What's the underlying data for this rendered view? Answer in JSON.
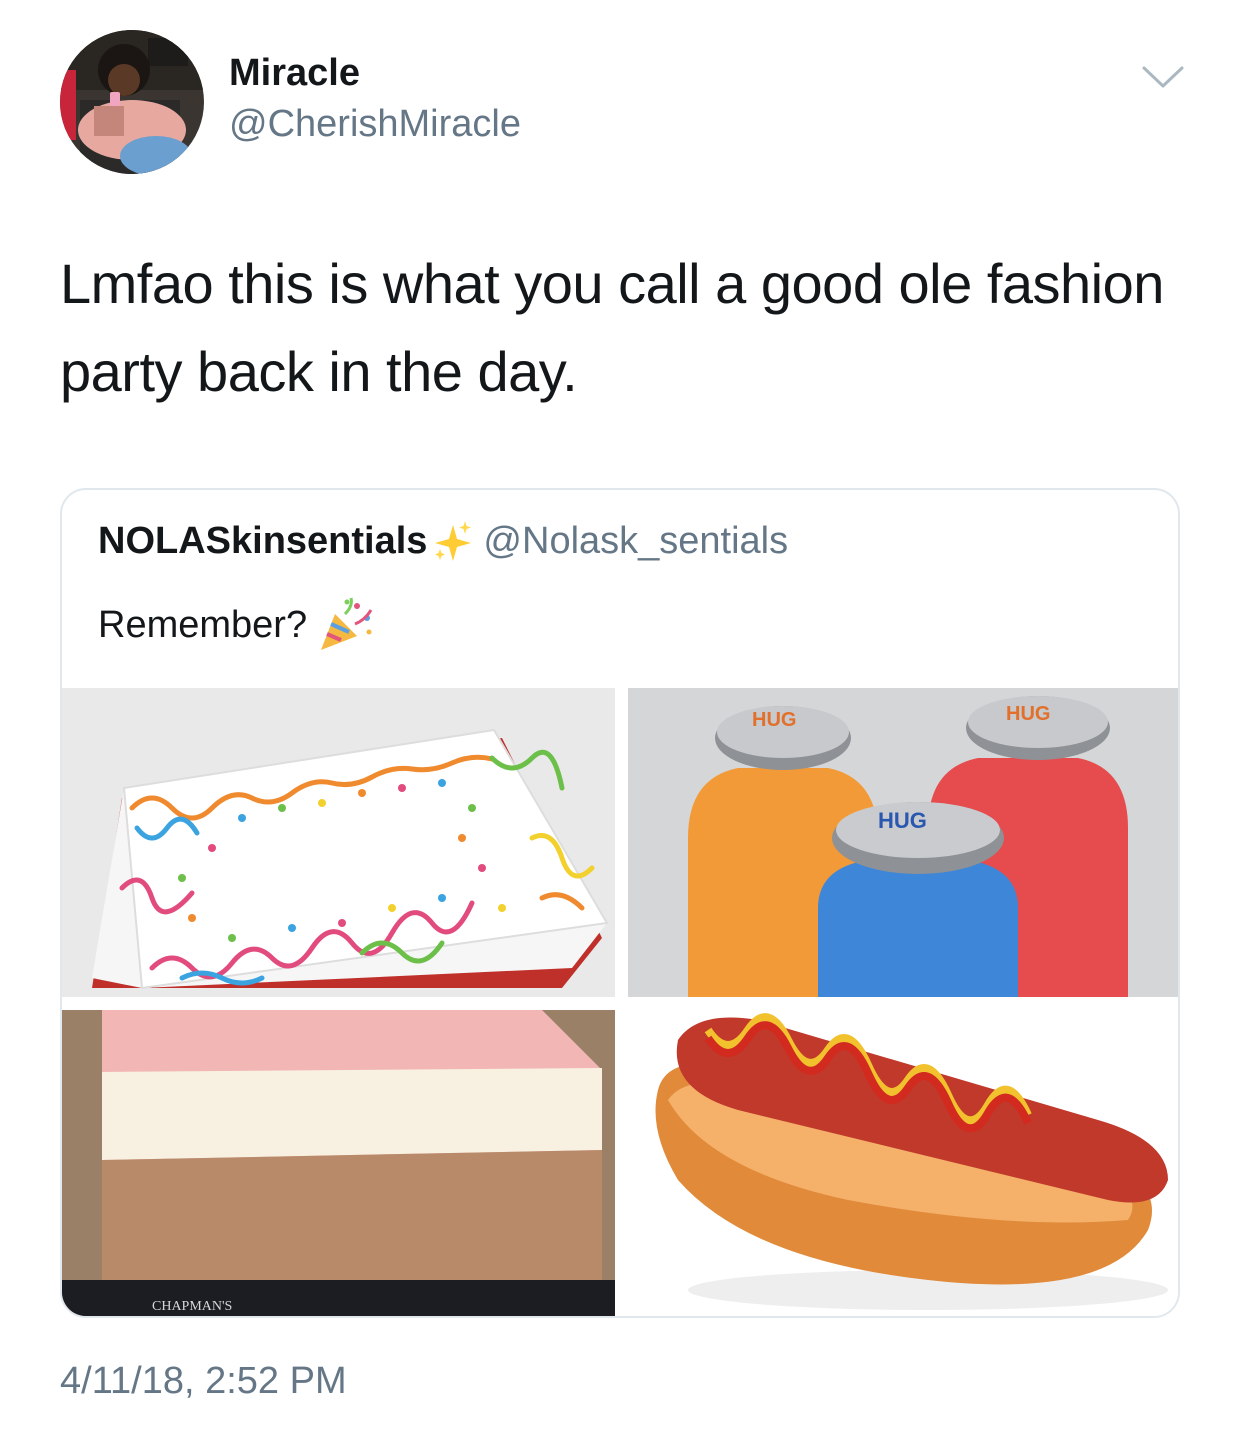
{
  "tweet": {
    "display_name": "Miracle",
    "handle": "@CherishMiracle",
    "text": "Lmfao this is what you call a good ole fashion party back in the day.",
    "timestamp": "4/11/18, 2:52 PM"
  },
  "quoted_tweet": {
    "display_name": "NOLASkinsentials",
    "handle": "@Nolask_sentials",
    "text": "Remember?",
    "name_emoji": "sparkles-icon",
    "text_emoji": "party-popper-icon",
    "media": [
      {
        "name": "sheet-cake-image",
        "bottle_cap_labels": []
      },
      {
        "name": "hug-juice-bottles-image",
        "bottle_cap_labels": [
          "HUG",
          "HUG",
          "HUG"
        ]
      },
      {
        "name": "neapolitan-ice-cream-image",
        "box_label": "CHAPMAN'S"
      },
      {
        "name": "hot-dog-image"
      }
    ]
  },
  "colors": {
    "text_primary": "#14171a",
    "text_secondary": "#657786",
    "border": "#e1e8ed"
  }
}
